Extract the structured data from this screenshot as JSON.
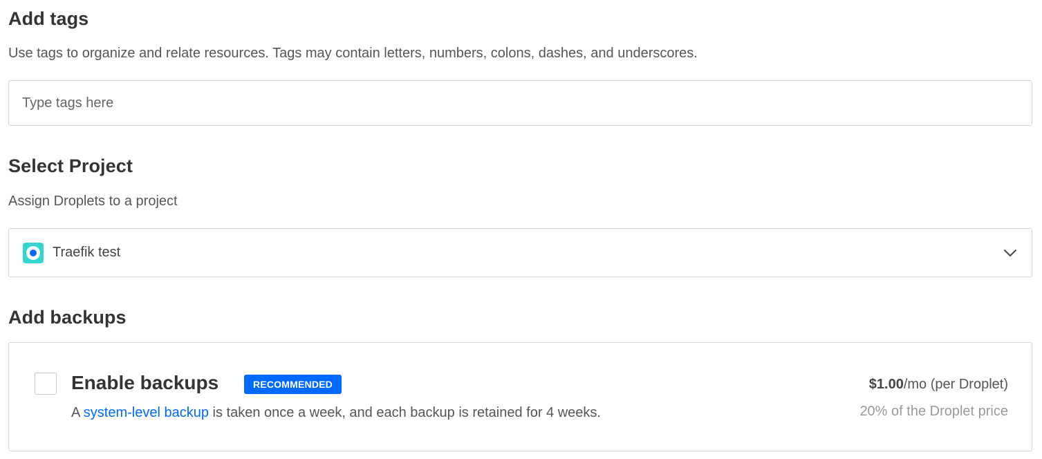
{
  "tags": {
    "title": "Add tags",
    "description": "Use tags to organize and relate resources. Tags may contain letters, numbers, colons, dashes, and underscores.",
    "input_placeholder": "Type tags here",
    "input_value": ""
  },
  "project": {
    "title": "Select Project",
    "description": "Assign Droplets to a project",
    "selected": "Traefik test",
    "icon": "project-icon",
    "dropdown_icon": "chevron-down-icon"
  },
  "backups": {
    "title": "Add backups",
    "option_label": "Enable backups",
    "badge": "RECOMMENDED",
    "desc_prefix": "A ",
    "desc_link": "system-level backup",
    "desc_suffix": " is taken once a week, and each backup is retained for 4 weeks.",
    "price_amount": "$1.00",
    "price_suffix": "/mo (per Droplet)",
    "price_note": "20% of the Droplet price",
    "checked": false
  },
  "colors": {
    "accent": "#0069ff",
    "project_icon_bg": "#33d6cf",
    "border": "#d6d6d6",
    "heading": "#333333"
  }
}
